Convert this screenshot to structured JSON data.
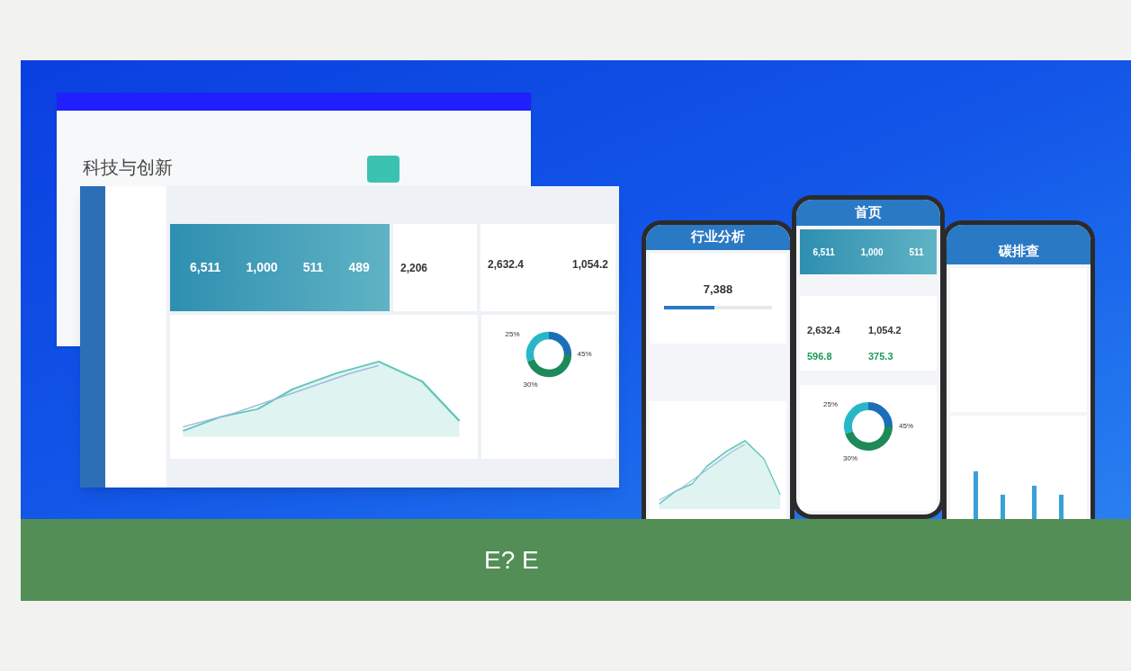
{
  "banner": {
    "back_window": {
      "headline": "科技与创新"
    },
    "dashboard": {
      "stats": [
        "6,511",
        "1,000",
        "511",
        "489"
      ],
      "card_2": {
        "value": "2,206"
      },
      "card_3": {
        "values": [
          "2,632.4",
          "1,054.2"
        ]
      },
      "donut": {
        "labels": [
          "25%",
          "45%",
          "30%"
        ]
      }
    },
    "phones": [
      {
        "kind": "analysis",
        "title": "行业分析",
        "values": [
          "7,388"
        ],
        "progress": {
          "level": 0.47
        }
      },
      {
        "kind": "home",
        "title": "首页",
        "stats": [
          "6,511",
          "1,000",
          "511"
        ],
        "values": [
          "2,632.4",
          "1,054.2"
        ],
        "highlights": [
          "596.8",
          "375.3"
        ],
        "donut_labels": [
          "25%",
          "45%",
          "30%"
        ]
      },
      {
        "kind": "bars",
        "title": "碳排查"
      }
    ]
  },
  "footer_bar": {
    "text": "E? E"
  }
}
